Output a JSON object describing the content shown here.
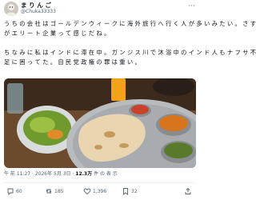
{
  "post": {
    "author_name": "ま り ん ご",
    "author_handle": "@Chuka33333",
    "more_icon": "more-dots-icon",
    "text_lines": [
      "う ち の 会 社 は ゴ ー ル デ ン ウ ィ ー ク に 海 外 旅 行 へ 行 く 人 が 多 い み た い 。 さ す",
      "が エ リ ー ト 企 業 っ て 感 じ だ ね 。",
      "ち な み に 私 は イ ン ド に 滞 在 中 。 ガ ン ジ ス 川 で 沐 浴 中 の イ ン ド 人 も ナ フ サ 不",
      "足 に 困 っ て た 。 自 民 党 政 権 の 罪 は 重 い 。"
    ],
    "time": "午 前 11:27 · 2026年 5月 3日 ·",
    "views_count": "12.3万",
    "views_label": "件 の 表 示"
  },
  "actions": {
    "reply_count": "60",
    "repost_count": "185",
    "like_count": "1,396",
    "bookmark_count": "32",
    "icons": [
      "reply-icon",
      "repost-icon",
      "like-icon",
      "bookmark-icon",
      "share-icon"
    ]
  }
}
